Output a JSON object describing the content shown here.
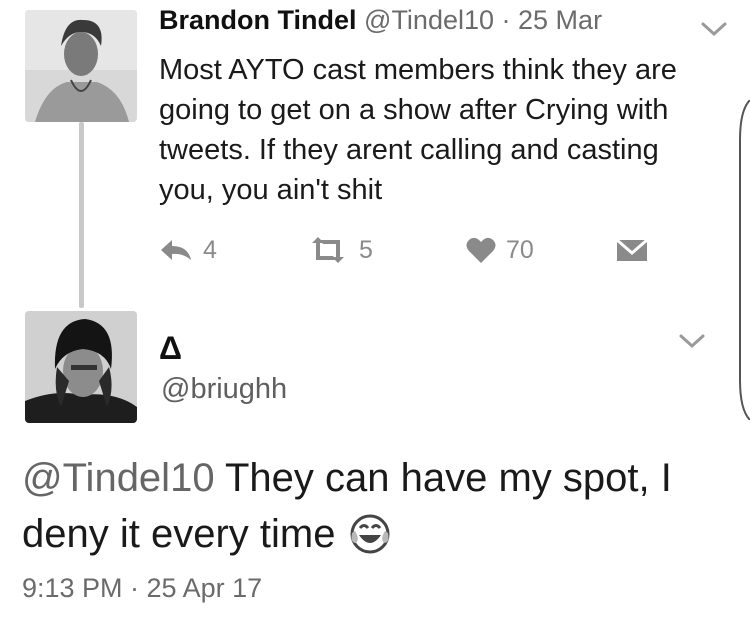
{
  "tweet1": {
    "name": "Brandon Tindel",
    "handle": "@Tindel10",
    "time": "· 25 Mar",
    "lines": [
      "Most AYTO cast members think they are",
      "going to get on a show after Crying with",
      "tweets. If they arent calling and casting",
      "you, you ain't shit"
    ],
    "replies": "4",
    "retweets": "5",
    "likes": "70",
    "icons": {
      "reply": "reply-icon",
      "retweet": "retweet-icon",
      "like": "heart-icon",
      "dm": "message-icon",
      "menu": "chevron-down-icon"
    }
  },
  "tweet2": {
    "name": "Δ",
    "handle": "@briughh",
    "mention": "@Tindel10",
    "line1_rest": " They can have my spot, I",
    "line2": "deny it every time",
    "emoji": "tears-of-joy-emoji",
    "timestamp": "9:13 PM · 25 Apr 17"
  },
  "colors": {
    "text": "#141414",
    "muted": "#6b6b6b",
    "icon": "#8a8a8a",
    "line": "#c9c9c9"
  }
}
